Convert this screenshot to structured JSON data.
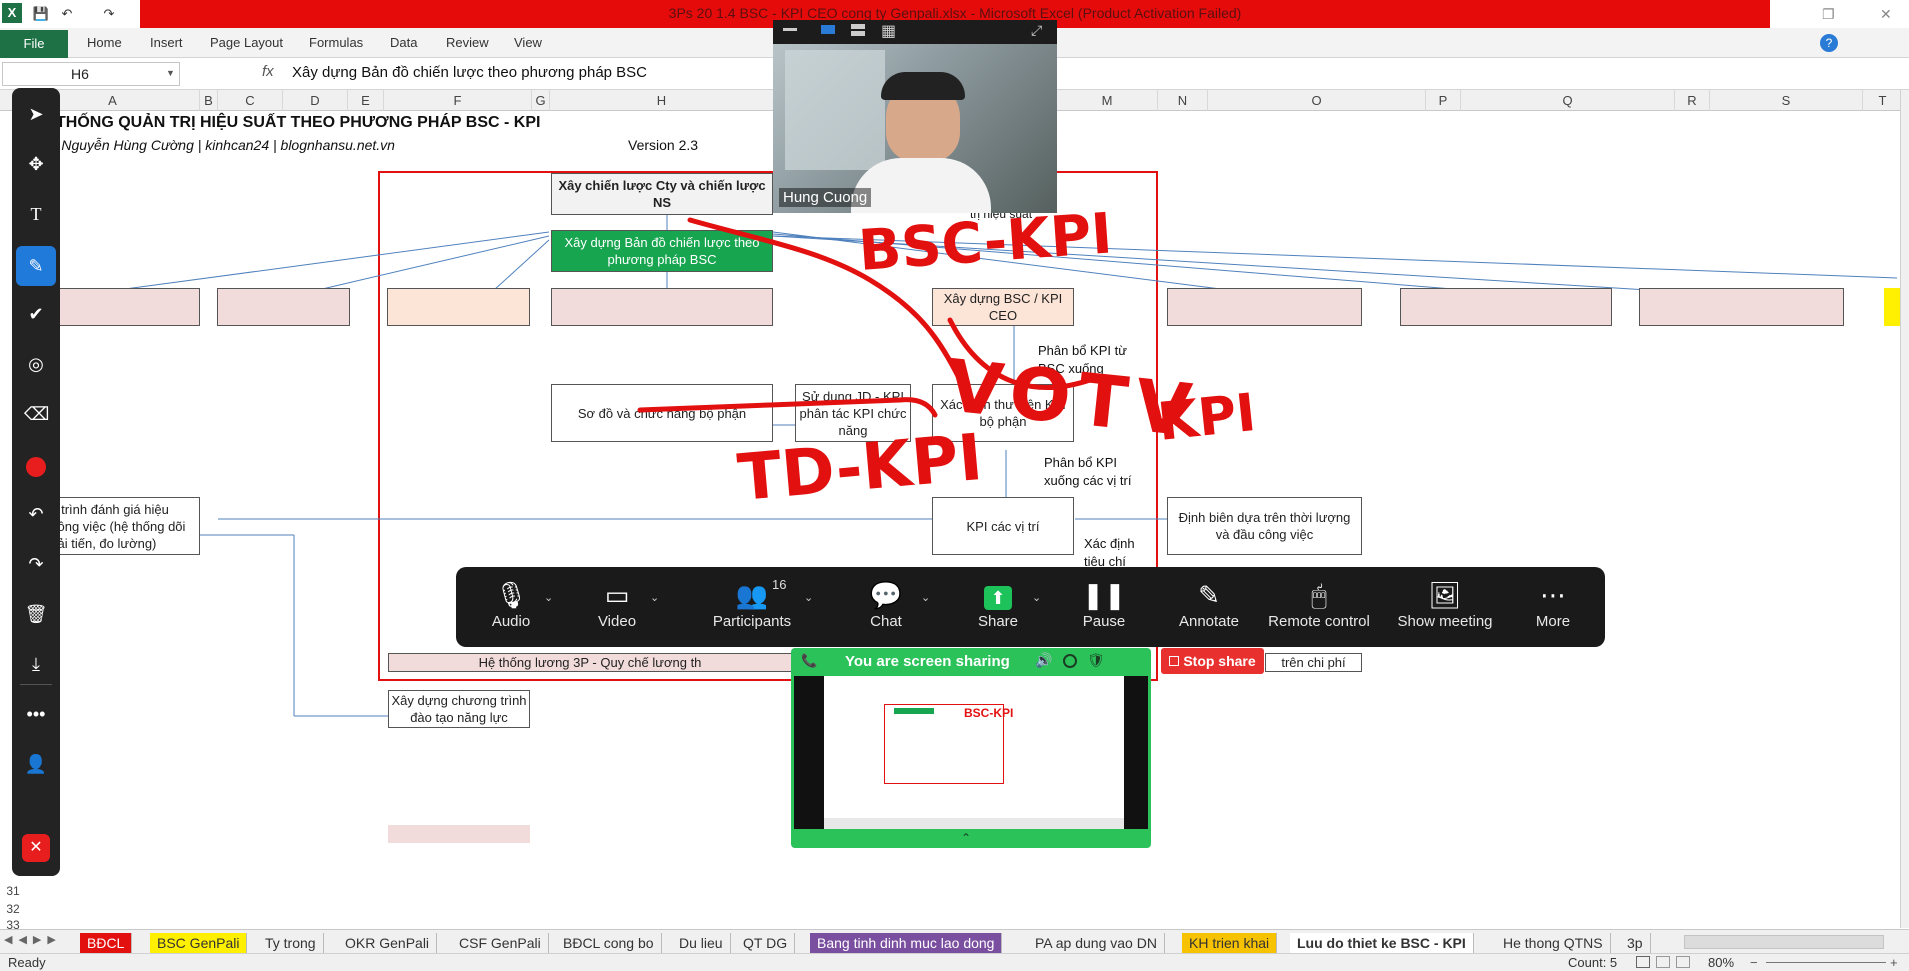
{
  "window": {
    "title": "3Ps 20 1.4 BSC - KPI CEO cong ty Genpali.xlsx - Microsoft Excel (Product Activation Failed)"
  },
  "ribbon": {
    "file": "File",
    "tabs": [
      "Home",
      "Insert",
      "Page Layout",
      "Formulas",
      "Data",
      "Review",
      "View"
    ]
  },
  "formula_bar": {
    "cell_ref": "H6",
    "fx": "fx",
    "content": "Xây dựng Bản đồ chiến lược theo phương pháp BSC"
  },
  "columns": [
    "A",
    "B",
    "C",
    "D",
    "E",
    "F",
    "G",
    "H",
    "M",
    "N",
    "O",
    "P",
    "Q",
    "R",
    "S",
    "T"
  ],
  "rows": [
    "31",
    "32",
    "33"
  ],
  "sheet": {
    "heading": "THỐNG QUẢN TRỊ HIỆU SUẤT THEO PHƯƠNG PHÁP BSC - KPI",
    "author": "ản: Nguyễn Hùng Cường | kinhcan24 | blognhansu.net.vn",
    "version": "Version 2.3",
    "boxes": {
      "strategy": "Xây chiến lược Cty và chiến lược NS",
      "bsc_map": "Xây dựng Bản đồ chiến lược theo phương pháp BSC",
      "bsc_ceo": "Xây dựng BSC / KPI CEO",
      "org_chart": "Sơ đồ và chức năng bộ phận",
      "jd_kpi": "Sử dụng JD - KPI phân tác KPI chức năng",
      "kpi_dept": "Xác định thư viện KPI bộ phận",
      "kpi_pos": "KPI các vị trí",
      "eval": "y trình đánh giá hiệu công việc (hệ thống dõi cải tiến, đo lường)",
      "staffing": "Định biên dựa trên thời lượng và đầu công việc",
      "training": "Xây dựng chương trình đào tạo năng lực",
      "salary": "Hệ thống lương 3P - Quy chế lương th",
      "cost": "trên chi phí"
    },
    "notes": {
      "perf": "trị hiệu suất",
      "kpi_from_bsc": "Phân bổ KPI từ BSC xuống",
      "kpi_to_pos": "Phân bổ KPI xuống các vị trí",
      "criteria": "Xác định tiêu chí"
    },
    "ink": [
      "BSC-KPI",
      "VOTV",
      "TD-KPI",
      "KPI"
    ]
  },
  "video": {
    "name": "Hung Cuong"
  },
  "zoom_toolbar": {
    "audio": "Audio",
    "video": "Video",
    "participants": "Participants",
    "participants_count": "16",
    "chat": "Chat",
    "share": "Share",
    "pause": "Pause",
    "annotate": "Annotate",
    "remote": "Remote control",
    "show_meeting": "Show meeting",
    "more": "More"
  },
  "sharing": {
    "status": "You are screen sharing",
    "stop": "Stop share"
  },
  "sheet_tabs": [
    "BĐCL",
    "BSC GenPali",
    "Ty trong",
    "OKR GenPali",
    "CSF GenPali",
    "BĐCL cong bo",
    "Du lieu",
    "QT DG",
    "Bang tinh dinh muc lao dong",
    "PA ap dung vao DN",
    "KH trien khai",
    "Luu do thiet ke BSC - KPI",
    "He thong QTNS",
    "3p"
  ],
  "status_bar": {
    "ready": "Ready",
    "count": "Count: 5",
    "zoom": "80%"
  },
  "colors": {
    "excel_green": "#1e7145",
    "title_red": "#e60b0b",
    "ink_red": "#e31010",
    "zoom_bg": "#1a1a1a",
    "share_green": "#2bc25a"
  }
}
